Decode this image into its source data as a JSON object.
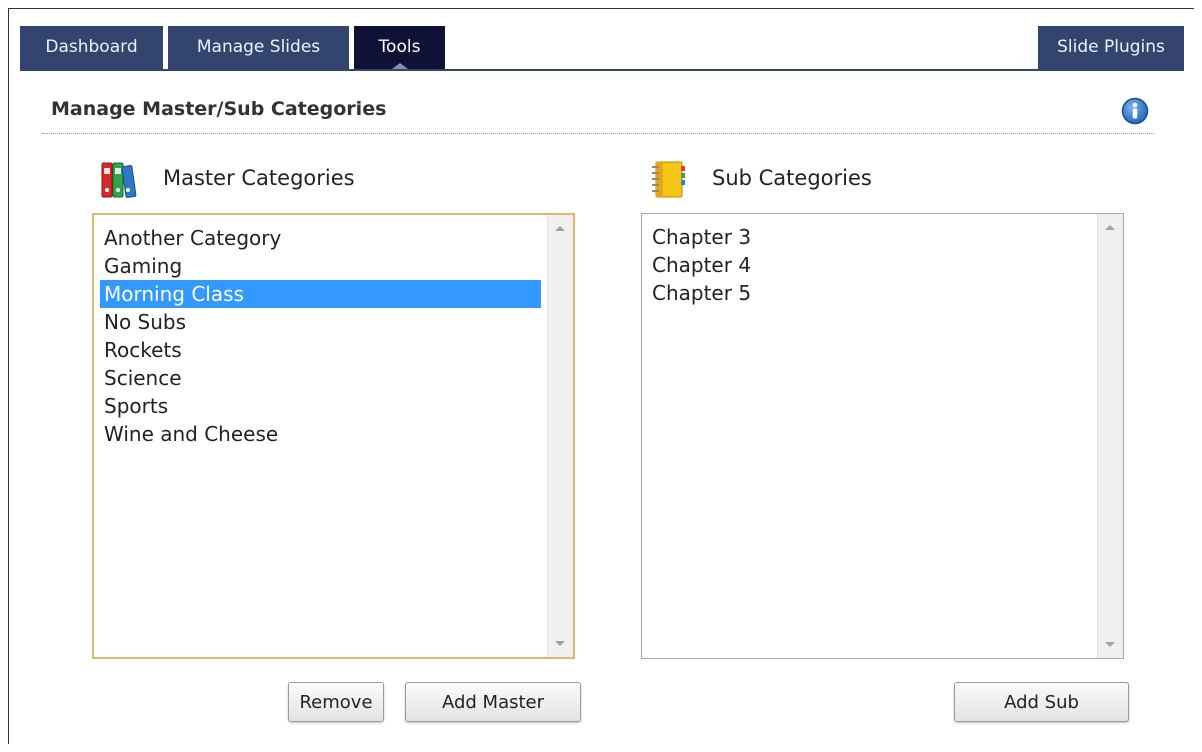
{
  "tabs": [
    {
      "label": "Dashboard",
      "active": false
    },
    {
      "label": "Manage Slides",
      "active": false
    },
    {
      "label": "Tools",
      "active": true
    },
    {
      "label": "Slide Plugins",
      "active": false
    }
  ],
  "section": {
    "title": "Manage Master/Sub Categories",
    "info_icon": "info-icon"
  },
  "master": {
    "heading": "Master Categories",
    "icon": "binders-icon",
    "items": [
      "Another Category",
      "Gaming",
      "Morning Class",
      "No Subs",
      "Rockets",
      "Science",
      "Sports",
      "Wine and Cheese"
    ],
    "selected": "Morning Class",
    "buttons": {
      "remove": "Remove",
      "add": "Add Master"
    }
  },
  "sub": {
    "heading": "Sub Categories",
    "icon": "notebook-icon",
    "items": [
      "Chapter 3",
      "Chapter 4",
      "Chapter 5"
    ],
    "buttons": {
      "add": "Add Sub"
    }
  },
  "colors": {
    "tab_bg": "#33456e",
    "tab_active_bg": "#0f1236",
    "selection": "#3399ff",
    "focus_border": "#e0b869"
  }
}
